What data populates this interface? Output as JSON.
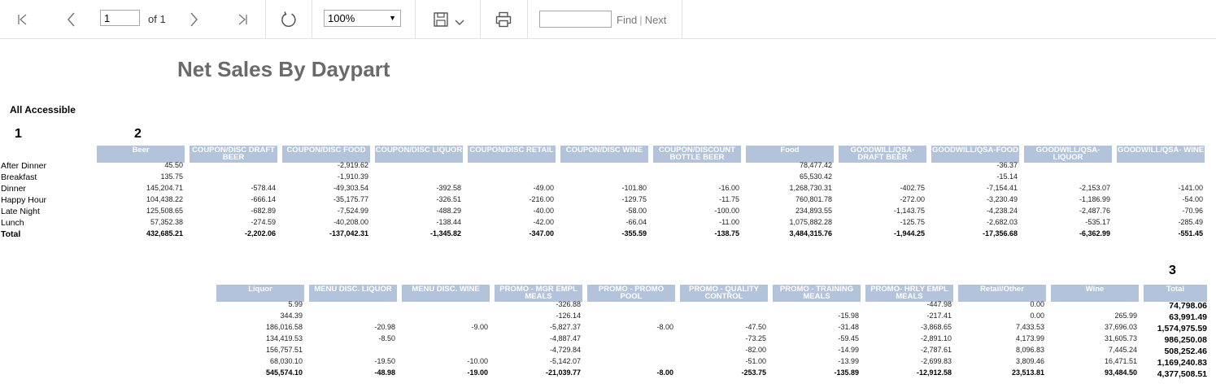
{
  "toolbar": {
    "page_value": "1",
    "page_of": "of 1",
    "zoom": "100%",
    "find_label": "Find",
    "find_separator": "|",
    "next_label": "Next"
  },
  "report": {
    "title": "Net Sales By Daypart",
    "subtitle": "All Accessible",
    "markers": [
      "1",
      "2",
      "3"
    ]
  },
  "rows": [
    "After Dinner",
    "Breakfast",
    "Dinner",
    "Happy Hour",
    "Late Night",
    "Lunch",
    "Total"
  ],
  "table1": {
    "headers": [
      "Beer",
      "COUPON/DISC DRAFT BEER",
      "COUPON/DISC FOOD",
      "COUPON/DISC LIQUOR",
      "COUPON/DISC RETAIL",
      "COUPON/DISC WINE",
      "COUPON/DISCOUNT BOTTLE BEER",
      "Food",
      "GOODWILL/QSA-DRAFT BEER",
      "GOODWILL/QSA-FOOD",
      "GOODWILL/QSA-LIQUOR",
      "GOODWILL/QSA- WINE"
    ],
    "values": [
      [
        "45.50",
        "",
        "-2,919.62",
        "",
        "",
        "",
        "",
        "78,477.42",
        "",
        "-36.37",
        "",
        ""
      ],
      [
        "135.75",
        "",
        "-1,910.39",
        "",
        "",
        "",
        "",
        "65,530.42",
        "",
        "-15.14",
        "",
        ""
      ],
      [
        "145,204.71",
        "-578.44",
        "-49,303.54",
        "-392.58",
        "-49.00",
        "-101.80",
        "-16.00",
        "1,268,730.31",
        "-402.75",
        "-7,154.41",
        "-2,153.07",
        "-141.00"
      ],
      [
        "104,438.22",
        "-666.14",
        "-35,175.77",
        "-326.51",
        "-216.00",
        "-129.75",
        "-11.75",
        "760,801.78",
        "-272.00",
        "-3,230.49",
        "-1,186.99",
        "-54.00"
      ],
      [
        "125,508.65",
        "-682.89",
        "-7,524.99",
        "-488.29",
        "-40.00",
        "-58.00",
        "-100.00",
        "234,893.55",
        "-1,143.75",
        "-4,238.24",
        "-2,487.76",
        "-70.96"
      ],
      [
        "57,352.38",
        "-274.59",
        "-40,208.00",
        "-138.44",
        "-42.00",
        "-66.04",
        "-11.00",
        "1,075,882.28",
        "-125.75",
        "-2,682.03",
        "-535.17",
        "-285.49"
      ],
      [
        "432,685.21",
        "-2,202.06",
        "-137,042.31",
        "-1,345.82",
        "-347.00",
        "-355.59",
        "-138.75",
        "3,484,315.76",
        "-1,944.25",
        "-17,356.68",
        "-6,362.99",
        "-551.45"
      ]
    ]
  },
  "table2": {
    "headers": [
      "Liquor",
      "MENU DISC. LIQUOR",
      "MENU DISC. WINE",
      "PROMO - MGR EMPL MEALS",
      "PROMO - PROMO POOL",
      "PROMO - QUALITY CONTROL",
      "PROMO - TRAINING MEALS",
      "PROMO- HRLY EMPL MEALS",
      "Retail/Other",
      "Wine",
      "Total"
    ],
    "values": [
      [
        "5.99",
        "",
        "",
        "-326.88",
        "",
        "",
        "",
        "-447.98",
        "0.00",
        "",
        "74,798.06"
      ],
      [
        "344.39",
        "",
        "",
        "-126.14",
        "",
        "",
        "-15.98",
        "-217.41",
        "0.00",
        "265.99",
        "63,991.49"
      ],
      [
        "186,016.58",
        "-20.98",
        "-9.00",
        "-5,827.37",
        "-8.00",
        "-47.50",
        "-31.48",
        "-3,868.65",
        "7,433.53",
        "37,696.03",
        "1,574,975.59"
      ],
      [
        "134,419.53",
        "-8.50",
        "",
        "-4,887.47",
        "",
        "-73.25",
        "-59.45",
        "-2,891.10",
        "4,173.99",
        "31,605.73",
        "986,250.08"
      ],
      [
        "156,757.51",
        "",
        "",
        "-4,729.84",
        "",
        "-82.00",
        "-14.99",
        "-2,787.61",
        "8,096.83",
        "7,445.24",
        "508,252.46"
      ],
      [
        "68,030.10",
        "-19.50",
        "-10.00",
        "-5,142.07",
        "",
        "-51.00",
        "-13.99",
        "-2,699.83",
        "3,809.46",
        "16,471.51",
        "1,169,240.83"
      ],
      [
        "545,574.10",
        "-48.98",
        "-19.00",
        "-21,039.77",
        "-8.00",
        "-253.75",
        "-135.89",
        "-12,912.58",
        "23,513.81",
        "93,484.50",
        "4,377,508.51"
      ]
    ]
  }
}
